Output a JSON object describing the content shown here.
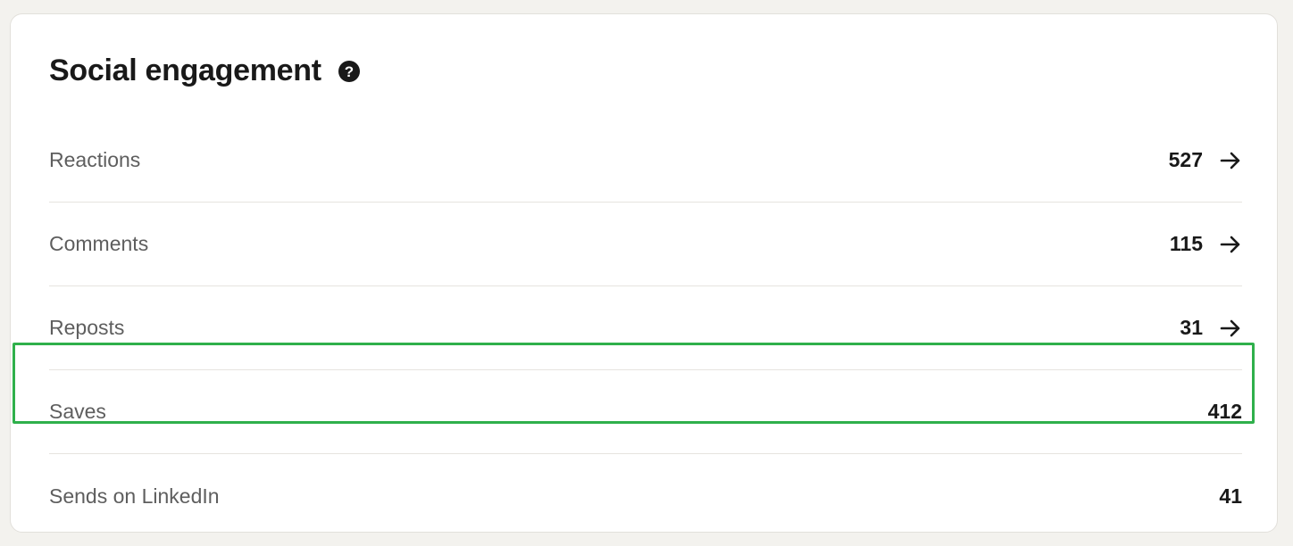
{
  "section": {
    "title": "Social engagement",
    "help_icon": "help-circle-icon"
  },
  "rows": [
    {
      "label": "Reactions",
      "value": "527",
      "has_arrow": true
    },
    {
      "label": "Comments",
      "value": "115",
      "has_arrow": true
    },
    {
      "label": "Reposts",
      "value": "31",
      "has_arrow": true
    },
    {
      "label": "Saves",
      "value": "412",
      "has_arrow": false,
      "highlighted": true
    },
    {
      "label": "Sends on LinkedIn",
      "value": "41",
      "has_arrow": false
    }
  ],
  "colors": {
    "highlight": "#2fb04b",
    "text_primary": "#191919",
    "text_secondary": "#5e5e5e",
    "page_background": "#f3f2ee"
  }
}
